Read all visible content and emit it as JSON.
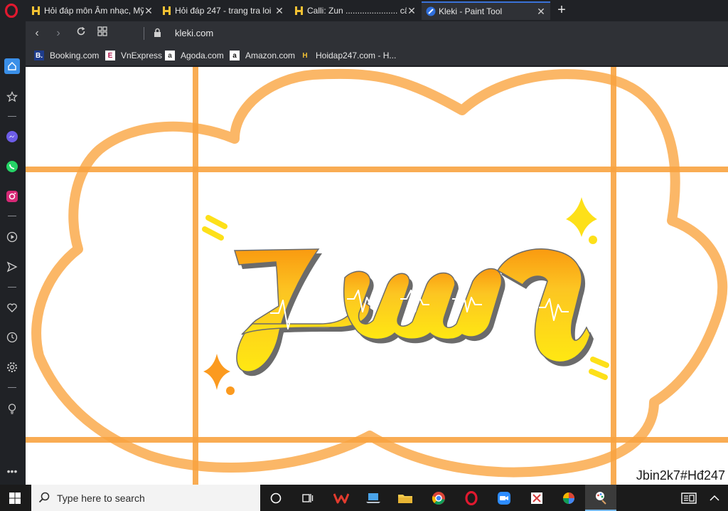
{
  "tabs": [
    {
      "title": "Hỏi đáp môn Âm nhạc, Mỹ",
      "icon": "hoidap-icon"
    },
    {
      "title": "Hỏi đáp 247 - trang tra loi",
      "icon": "hoidap-icon"
    },
    {
      "title": "Calli: Zun ...................... câu h",
      "icon": "hoidap-icon"
    },
    {
      "title": "Kleki - Paint Tool",
      "icon": "kleki-icon"
    }
  ],
  "address": {
    "url": "kleki.com"
  },
  "bookmarks": [
    {
      "label": "Booking.com",
      "icon": "booking-icon",
      "glyph": "B."
    },
    {
      "label": "VnExpress",
      "icon": "vnexpress-icon",
      "glyph": "E"
    },
    {
      "label": "Agoda.com",
      "icon": "agoda-icon",
      "glyph": "a"
    },
    {
      "label": "Amazon.com",
      "icon": "amazon-icon",
      "glyph": "a"
    },
    {
      "label": "Hoidap247.com - H...",
      "icon": "hoidap-icon",
      "glyph": "H"
    }
  ],
  "drawing": {
    "lettering": "Zun",
    "signature": "Jbin2k7#Hđ247",
    "colors": {
      "frame": "#fbb15a",
      "grid": "#f9a441",
      "top": "#fa9a10",
      "bottom": "#ffe812",
      "outline": "#6b6b6b",
      "sparkle_yellow": "#fde019",
      "sparkle_orange": "#fb9a1f"
    }
  },
  "taskbar": {
    "search_placeholder": "Type here to search"
  }
}
